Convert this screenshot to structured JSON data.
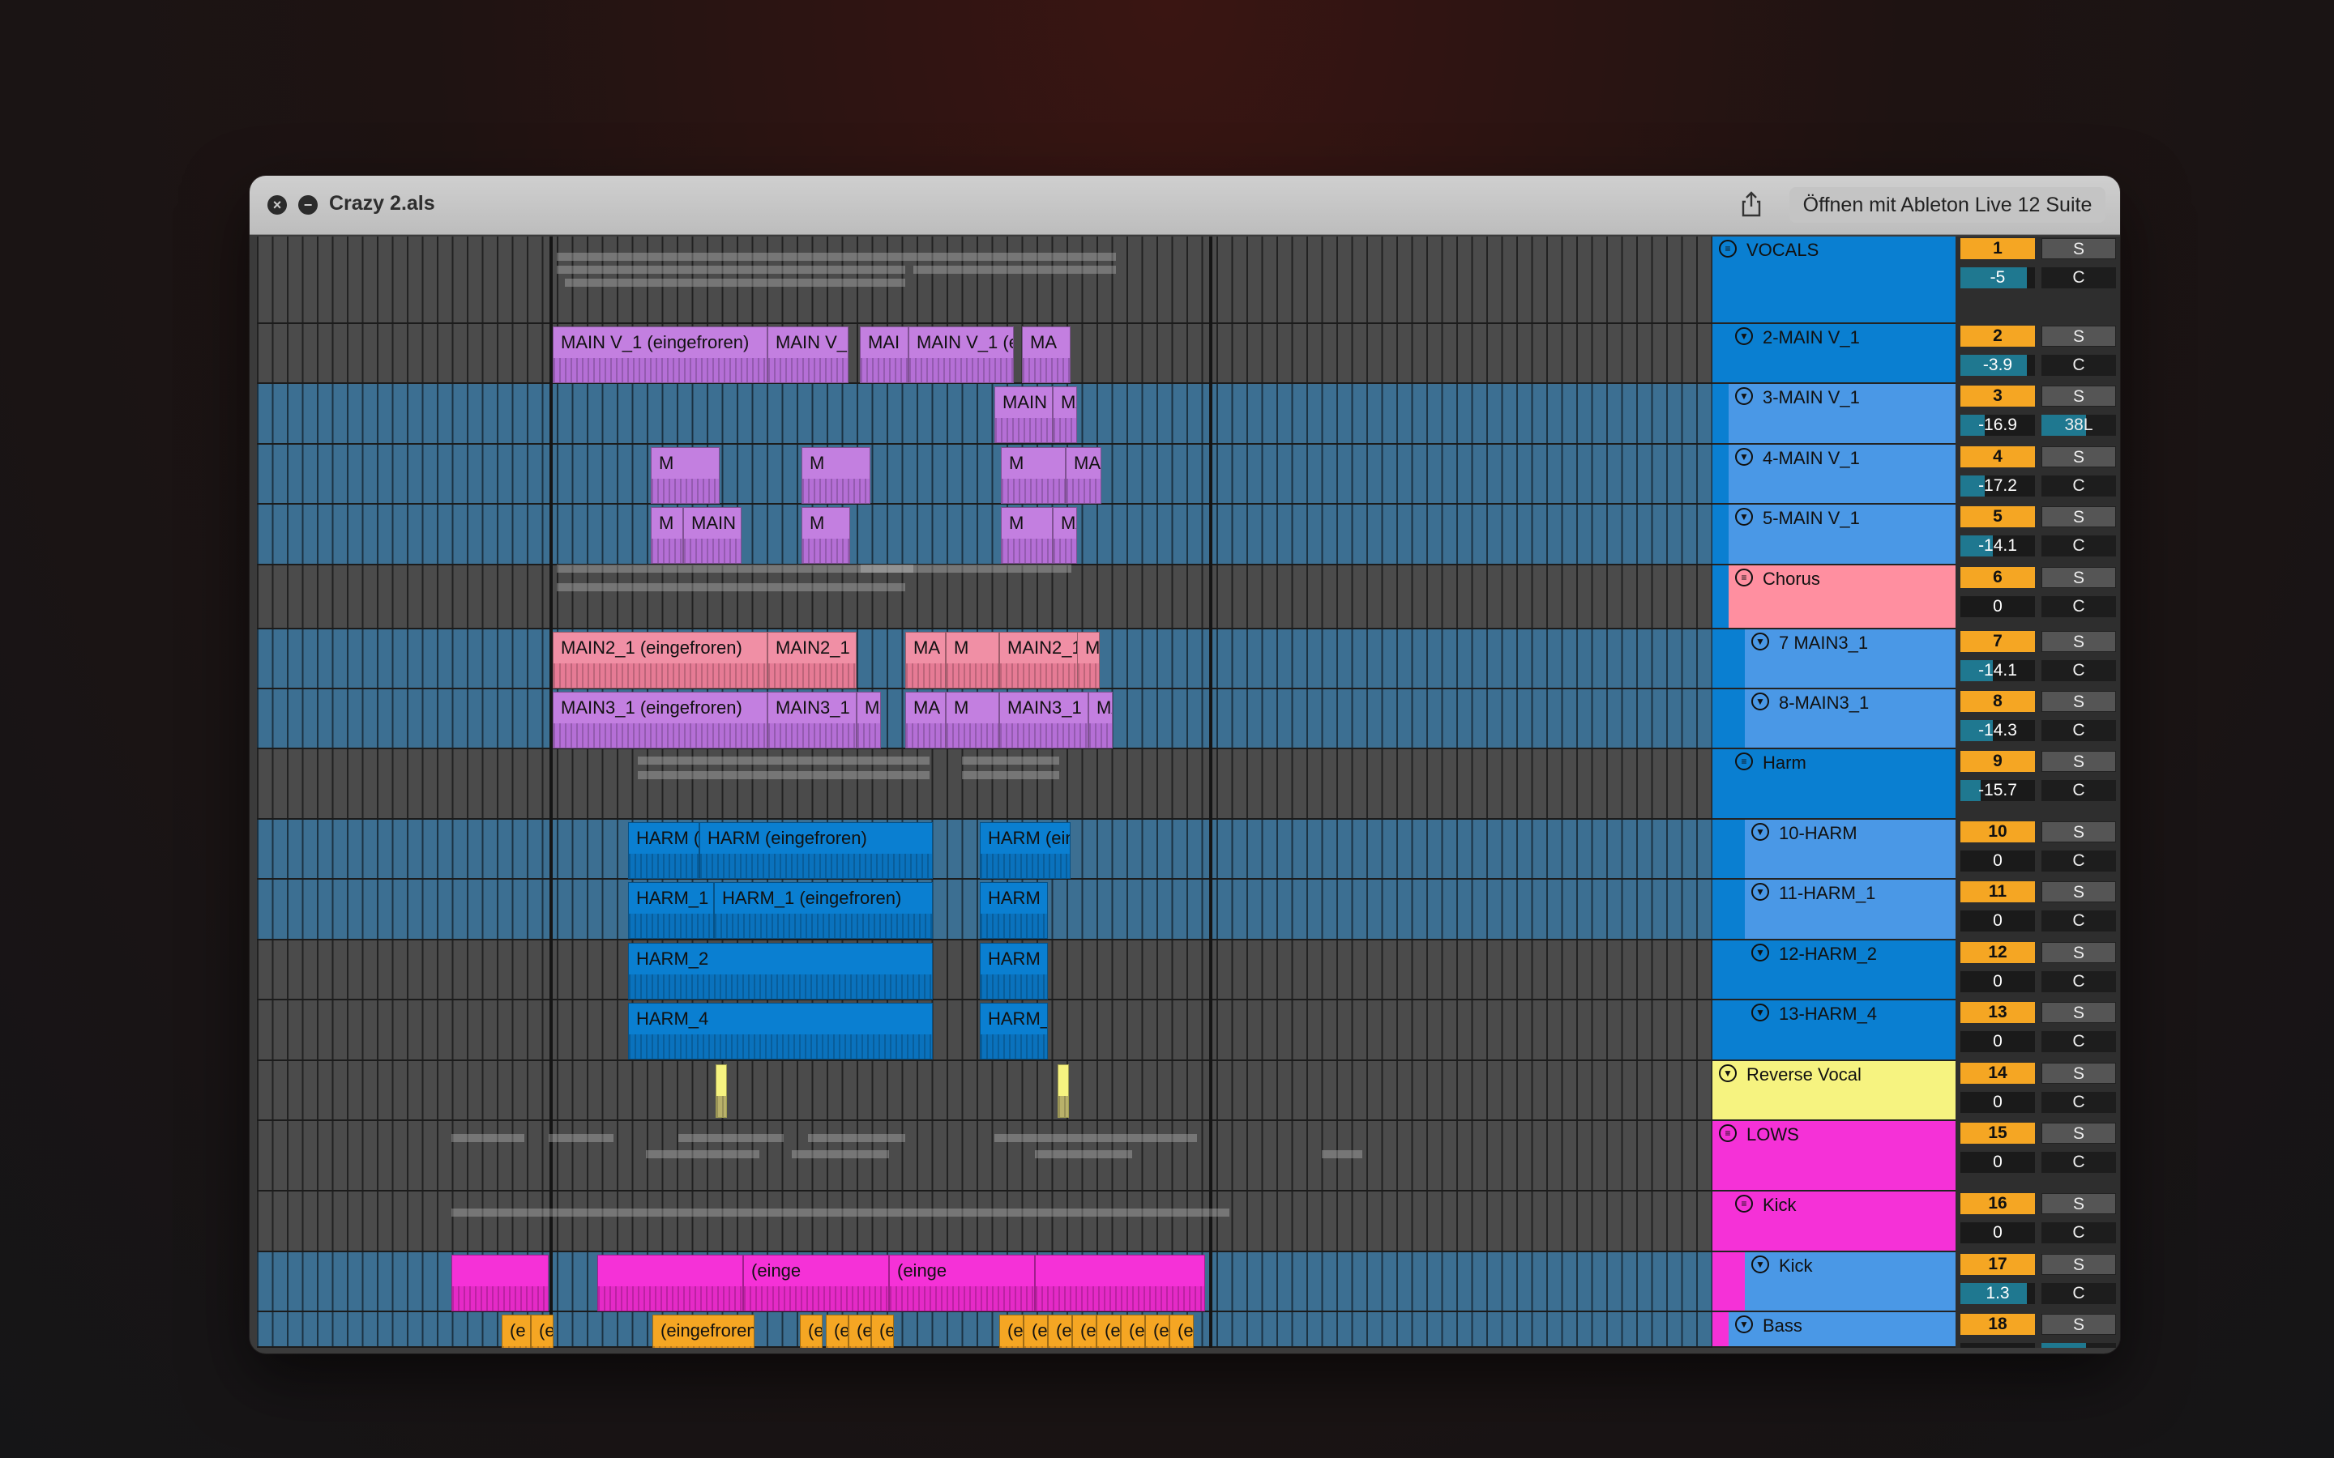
{
  "window": {
    "title": "Crazy 2.als",
    "open_button": "Öffnen mit Ableton Live 12 Suite"
  },
  "colors": {
    "vocals": "#0a7fd1",
    "track_blue": "#4a98e6",
    "chorus": "#ff8fa0",
    "lows": "#f531d7",
    "reverse": "#f6f380",
    "clip_violet": "#c37fe0",
    "clip_pink": "#f08fa5",
    "clip_orange": "#f5a623"
  },
  "tracks": [
    {
      "name": "VOCALS",
      "icon": "group-icon",
      "num": "1",
      "volume": "-5",
      "solo": "S",
      "pan": "C"
    },
    {
      "name": "2-MAIN V_1",
      "icon": "chevron-down-icon",
      "num": "2",
      "volume": "-3.9",
      "solo": "S",
      "pan": "C"
    },
    {
      "name": "3-MAIN V_1",
      "icon": "chevron-down-icon",
      "num": "3",
      "volume": "-16.9",
      "solo": "S",
      "pan": "38L"
    },
    {
      "name": "4-MAIN V_1",
      "icon": "chevron-down-icon",
      "num": "4",
      "volume": "-17.2",
      "solo": "S",
      "pan": "C"
    },
    {
      "name": "5-MAIN V_1",
      "icon": "chevron-down-icon",
      "num": "5",
      "volume": "-14.1",
      "solo": "S",
      "pan": "C"
    },
    {
      "name": "Chorus",
      "icon": "group-icon",
      "num": "6",
      "volume": "0",
      "solo": "S",
      "pan": "C"
    },
    {
      "name": "7 MAIN3_1",
      "icon": "chevron-down-icon",
      "num": "7",
      "volume": "-14.1",
      "solo": "S",
      "pan": "C"
    },
    {
      "name": "8-MAIN3_1",
      "icon": "chevron-down-icon",
      "num": "8",
      "volume": "-14.3",
      "solo": "S",
      "pan": "C"
    },
    {
      "name": "Harm",
      "icon": "group-icon",
      "num": "9",
      "volume": "-15.7",
      "solo": "S",
      "pan": "C"
    },
    {
      "name": "10-HARM",
      "icon": "chevron-down-icon",
      "num": "10",
      "volume": "0",
      "solo": "S",
      "pan": "C"
    },
    {
      "name": "11-HARM_1",
      "icon": "chevron-down-icon",
      "num": "11",
      "volume": "0",
      "solo": "S",
      "pan": "C"
    },
    {
      "name": "12-HARM_2",
      "icon": "chevron-down-icon",
      "num": "12",
      "volume": "0",
      "solo": "S",
      "pan": "C"
    },
    {
      "name": "13-HARM_4",
      "icon": "chevron-down-icon",
      "num": "13",
      "volume": "0",
      "solo": "S",
      "pan": "C"
    },
    {
      "name": "Reverse Vocal",
      "icon": "chevron-down-icon",
      "num": "14",
      "volume": "0",
      "solo": "S",
      "pan": "C"
    },
    {
      "name": "LOWS",
      "icon": "group-icon",
      "num": "15",
      "volume": "0",
      "solo": "S",
      "pan": "C"
    },
    {
      "name": "Kick",
      "icon": "group-icon",
      "num": "16",
      "volume": "0",
      "solo": "S",
      "pan": "C"
    },
    {
      "name": "Kick",
      "icon": "chevron-down-icon",
      "num": "17",
      "volume": "1.3",
      "solo": "S",
      "pan": "C"
    },
    {
      "name": "Bass",
      "icon": "chevron-down-icon",
      "num": "18",
      "volume": "",
      "solo": "S",
      "pan": ""
    }
  ],
  "clips": {
    "main_v1_a": "MAIN V_1 (eingefroren)",
    "main_v1_b": "MAIN V_1",
    "main_v1_c": "MAIN V_1 (e",
    "main_v1_d": "MAI",
    "main_v1_e": "MA",
    "main_v_short": "MAIN V",
    "main_v1_m": "M",
    "main_v1_main": "MAIN",
    "main2_a": "MAIN2_1 (eingefroren)",
    "main2_b": "MAIN2_1",
    "main3_a": "MAIN3_1 (eingefroren)",
    "main3_b": "MAIN3_1",
    "harm_e": "HARM (e",
    "harm_a": "HARM (eingefroren)",
    "harm_ei": "HARM (ein",
    "harm1": "HARM_1",
    "harm1_a": "HARM_1 (eingefroren)",
    "harm_short": "HARM",
    "harm2": "HARM_2",
    "harm4": "HARM_4",
    "harm_und": "HARM_",
    "kick_einge": "(einge",
    "bass_a": "(eingefroren)",
    "bass_e": "(e"
  }
}
